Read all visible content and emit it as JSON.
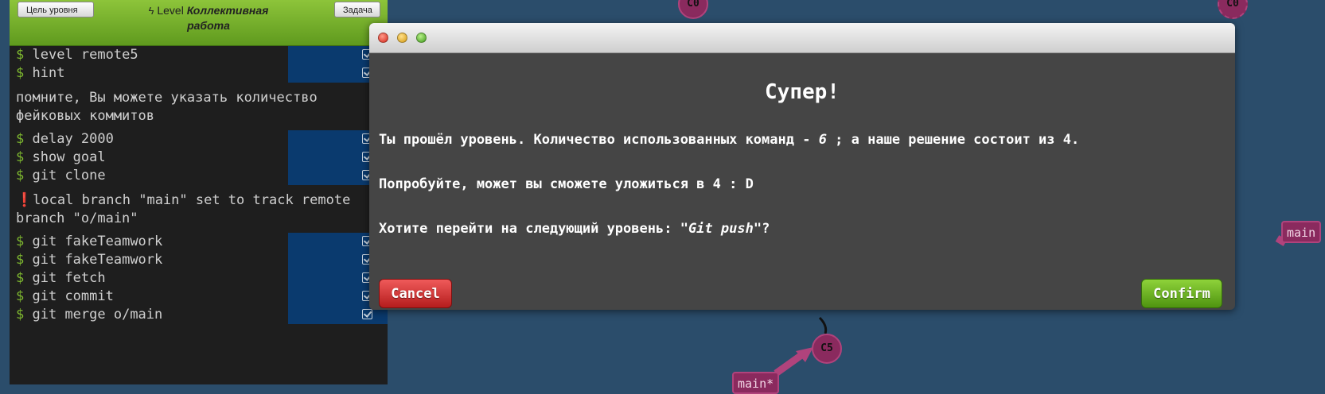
{
  "sidebar": {
    "goal_button": "Цель уровня",
    "task_button": "Задача",
    "level_prefix": "Level",
    "level_name": "Коллективная работа"
  },
  "terminal": {
    "prompt": "$",
    "block1": [
      "level remote5",
      "hint"
    ],
    "message1": "помните, Вы можете указать количество фейковых коммитов",
    "block2": [
      "delay 2000",
      "show goal",
      "git clone"
    ],
    "message2": "local branch \"main\" set to track remote branch \"o/main\"",
    "block3": [
      "git fakeTeamwork",
      "git fakeTeamwork",
      "git fetch",
      "git commit",
      "git merge o/main"
    ]
  },
  "graph": {
    "node_c0_left": "C0",
    "node_c0_right": "C0",
    "node_c5": "C5",
    "branch_main_right": "main",
    "branch_main_local": "main*"
  },
  "dialog": {
    "title": "Супер!",
    "line1_a": "Ты прошёл уровень. Количество использованных команд - ",
    "line1_num": "6",
    "line1_b": " ; а наше решение состоит из 4.",
    "line2": "Попробуйте, может вы сможете уложиться в 4 : D",
    "line3_a": "Хотите перейти на следующий уровень: ",
    "line3_level": "\"Git push\"",
    "line3_b": "?",
    "cancel": "Cancel",
    "confirm": "Confirm"
  },
  "colors": {
    "background": "#2b4d6b",
    "terminal": "#1e1e1e",
    "commit": "#8a2a5e",
    "command_bg": "#0a3a6e",
    "cancel": "#c8292b",
    "confirm": "#6cb325"
  }
}
